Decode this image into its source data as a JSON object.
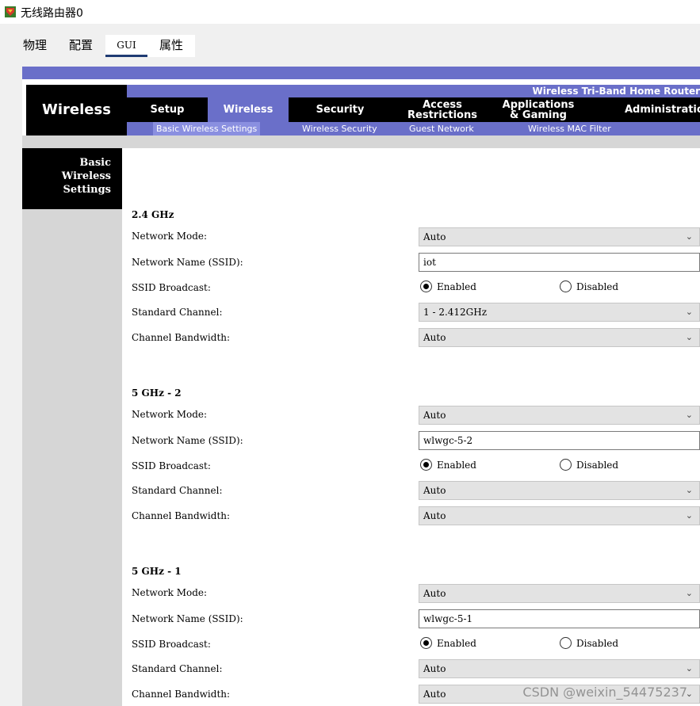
{
  "window": {
    "title": "无线路由器0",
    "icon": "router-app-icon"
  },
  "tabs": [
    {
      "label": "物理"
    },
    {
      "label": "配置"
    },
    {
      "label": "GUI",
      "active": true
    },
    {
      "label": "属性"
    }
  ],
  "header": {
    "brand": "Wireless",
    "model": "Wireless Tri-Band Home Router",
    "nav": [
      {
        "label": "Setup"
      },
      {
        "label": "Wireless",
        "active": true
      },
      {
        "label": "Security"
      },
      {
        "label": "Access\nRestrictions"
      },
      {
        "label": "Applications\n& Gaming"
      },
      {
        "label": "Administration"
      }
    ],
    "subnav": [
      {
        "label": "Basic Wireless Settings",
        "active": true
      },
      {
        "label": "Wireless Security"
      },
      {
        "label": "Guest Network"
      },
      {
        "label": "Wireless MAC Filter"
      }
    ],
    "accent_color": "#6a6fc9"
  },
  "sidebar": {
    "label": "Basic\nWireless\nSettings"
  },
  "labels": {
    "network_mode": "Network Mode:",
    "network_name": "Network Name (SSID):",
    "ssid_broadcast": "SSID Broadcast:",
    "standard_channel": "Standard Channel:",
    "channel_bandwidth": "Channel Bandwidth:",
    "enabled": "Enabled",
    "disabled": "Disabled"
  },
  "bands": [
    {
      "title": "2.4 GHz",
      "network_mode": "Auto",
      "ssid": "iot",
      "broadcast": "Enabled",
      "channel": "1 - 2.412GHz",
      "bandwidth": "Auto"
    },
    {
      "title": "5 GHz - 2",
      "network_mode": "Auto",
      "ssid": "wlwgc-5-2",
      "broadcast": "Enabled",
      "channel": "Auto",
      "bandwidth": "Auto"
    },
    {
      "title": "5 GHz - 1",
      "network_mode": "Auto",
      "ssid": "wlwgc-5-1",
      "broadcast": "Enabled",
      "channel": "Auto",
      "bandwidth": "Auto"
    }
  ],
  "watermark": "CSDN @weixin_54475237"
}
